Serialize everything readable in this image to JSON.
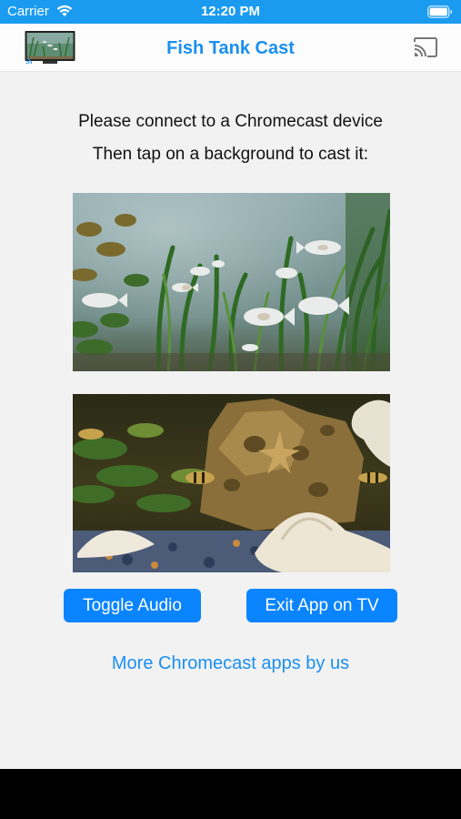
{
  "status_bar": {
    "carrier": "Carrier",
    "time": "12:20 PM"
  },
  "nav": {
    "title": "Fish Tank Cast",
    "logo_icon": "tv-aquarium-logo-icon",
    "cast_icon": "chromecast-icon"
  },
  "content": {
    "instruction_1": "Please connect to a Chromecast device",
    "instruction_2": "Then tap on a background to cast it:",
    "backgrounds": [
      {
        "name": "aquarium-background-1"
      },
      {
        "name": "aquarium-background-2"
      }
    ],
    "toggle_audio_label": "Toggle Audio",
    "exit_app_label": "Exit App on TV",
    "more_apps_label": "More Chromecast apps by us"
  },
  "colors": {
    "status_bar": "#1a9bf0",
    "accent": "#1a8ff0",
    "button": "#0a84ff",
    "background": "#f2f2f3"
  }
}
